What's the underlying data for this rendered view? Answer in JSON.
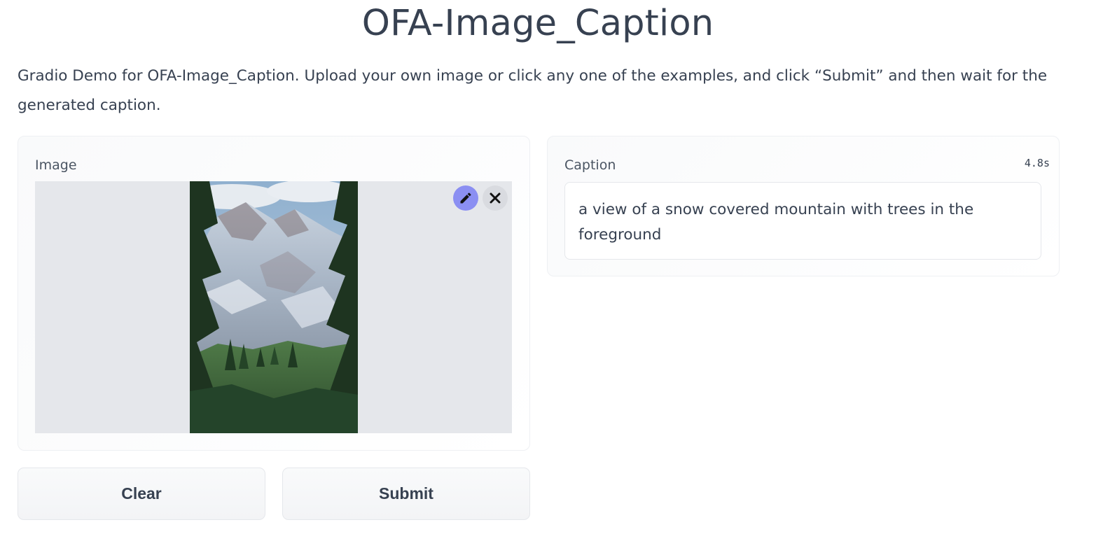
{
  "app": {
    "title": "OFA-Image_Caption",
    "description": "Gradio Demo for OFA-Image_Caption. Upload your own image or click any one of the examples, and click “Submit” and then wait for the generated caption."
  },
  "input": {
    "label": "Image",
    "edit_icon": "pencil-icon",
    "clear_icon": "close-icon"
  },
  "output": {
    "label": "Caption",
    "timer": "4.8s",
    "caption": "a view of a snow covered mountain with trees in the foreground"
  },
  "actions": {
    "clear_label": "Clear",
    "submit_label": "Submit"
  },
  "colors": {
    "accent": "#8b8ff2",
    "text": "#374151",
    "image_bg": "#e5e7eb"
  }
}
